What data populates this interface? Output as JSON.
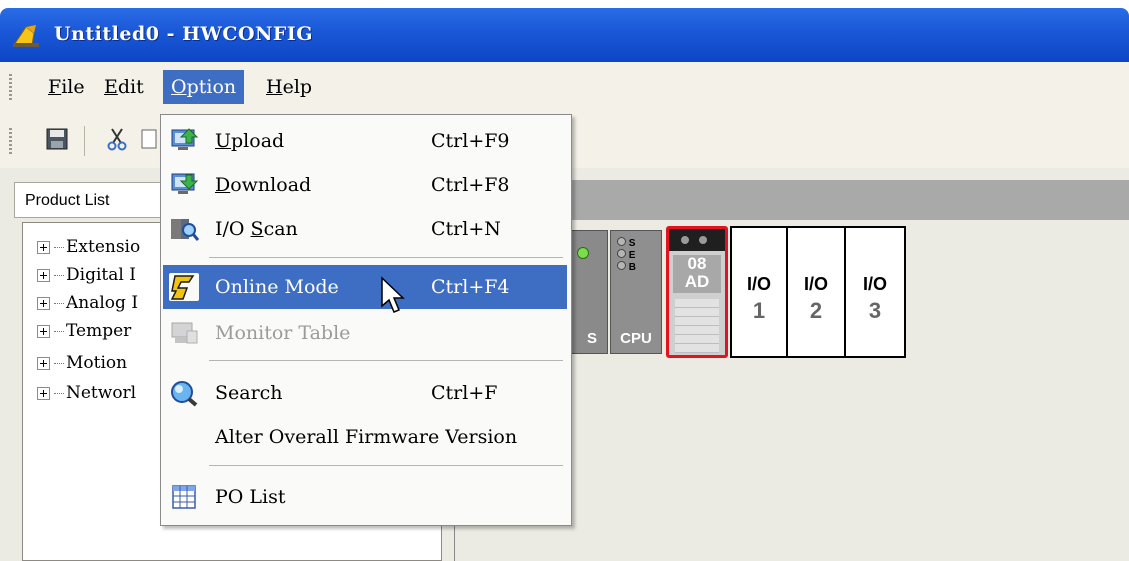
{
  "window": {
    "title": "Untitled0 - HWCONFIG"
  },
  "menubar": {
    "file": {
      "prefix": "",
      "mnemonic": "F",
      "rest": "ile"
    },
    "edit": {
      "prefix": "",
      "mnemonic": "E",
      "rest": "dit"
    },
    "option": {
      "prefix": "",
      "mnemonic": "O",
      "rest": "ption"
    },
    "help": {
      "prefix": "",
      "mnemonic": "H",
      "rest": "elp"
    }
  },
  "product_list": {
    "header": "Product List",
    "items": [
      {
        "label": "Extensio"
      },
      {
        "label": "Digital I"
      },
      {
        "label": "Analog I"
      },
      {
        "label": "Temper"
      },
      {
        "label": "Motion"
      },
      {
        "label": "Networl"
      }
    ]
  },
  "option_menu": {
    "items": [
      {
        "mnemonic": "U",
        "rest": "pload",
        "shortcut": "Ctrl+F9",
        "icon": "upload-icon"
      },
      {
        "mnemonic": "D",
        "rest": "ownload",
        "shortcut": "Ctrl+F8",
        "icon": "download-icon"
      },
      {
        "prefix": "I/O ",
        "mnemonic": "S",
        "rest": "can",
        "shortcut": "Ctrl+N",
        "icon": "io-scan-icon"
      },
      {
        "label": "Online Mode",
        "shortcut": "Ctrl+F4",
        "icon": "online-mode-icon",
        "highlighted": true
      },
      {
        "label": "Monitor Table",
        "shortcut": "",
        "icon": "monitor-table-icon",
        "disabled": true
      },
      {
        "label": "Search",
        "shortcut": "Ctrl+F",
        "icon": "search-icon"
      },
      {
        "label": "Alter Overall Firmware Version",
        "shortcut": ""
      },
      {
        "label": "PO List",
        "shortcut": "",
        "icon": "po-list-icon"
      }
    ]
  },
  "rack": {
    "ps_label": "S",
    "cpu": {
      "leds": [
        "S",
        "E",
        "B"
      ],
      "label": "CPU"
    },
    "ad_module": {
      "line1": "08",
      "line2": "AD"
    },
    "io_slots": [
      {
        "label": "I/O",
        "number": "1"
      },
      {
        "label": "I/O",
        "number": "2"
      },
      {
        "label": "I/O",
        "number": "3"
      }
    ]
  },
  "colors": {
    "highlight": "#3d6ec4",
    "title_bar": "#1b59d8",
    "selected_module_border": "#e0141e"
  }
}
